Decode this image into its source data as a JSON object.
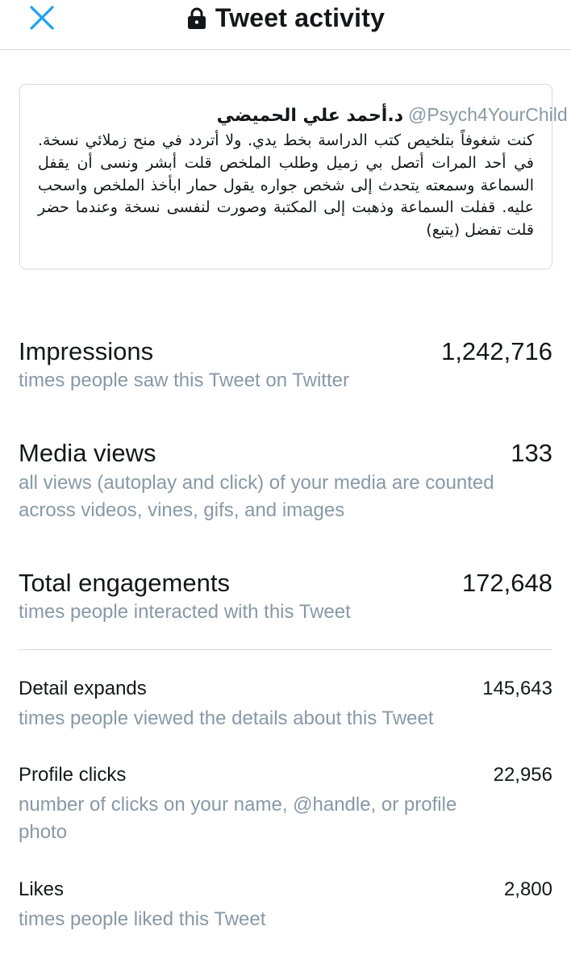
{
  "header": {
    "title": "Tweet activity",
    "close_icon": "close-icon",
    "lock_icon": "lock-icon"
  },
  "tweet": {
    "author": "د.أحمد علي الحميضي",
    "handle": "@Psych4YourChild",
    "text": "كنت شغوفاً بتلخيص كتب الدراسة بخط يدي. ولا أتردد في منح زملائي نسخة. في أحد المرات أتصل بي زميل وطلب الملخص قلت أبشر ونسى أن يقفل السماعة وسمعته يتحدث إلى شخص جواره يقول حمار ابأخذ الملخص واسحب عليه. قفلت السماعة وذهبت إلى المكتبة وصورت لنفسى نسخة وعندما حضر قلت تفضل (يتبع)"
  },
  "metrics": {
    "impressions": {
      "label": "Impressions",
      "value": "1,242,716",
      "desc": "times people saw this Tweet on Twitter"
    },
    "media_views": {
      "label": "Media views",
      "value": "133",
      "desc_line1": "all views (autoplay and click) of your media are counted",
      "desc_line2": "across videos, vines, gifs, and images"
    },
    "total_engagements": {
      "label": "Total engagements",
      "value": "172,648",
      "desc": "times people interacted with this Tweet"
    },
    "detail_expands": {
      "label": "Detail expands",
      "value": "145,643",
      "desc": "times people viewed the details about this Tweet"
    },
    "profile_clicks": {
      "label": "Profile clicks",
      "value": "22,956",
      "desc_line1": "number of clicks on your name, @handle, or profile",
      "desc_line2": "photo"
    },
    "likes": {
      "label": "Likes",
      "value": "2,800",
      "desc": "times people liked this Tweet"
    }
  },
  "colors": {
    "accent": "#1da1f2",
    "text": "#14171a",
    "muted": "#8899a6",
    "border": "#d4d9de"
  }
}
